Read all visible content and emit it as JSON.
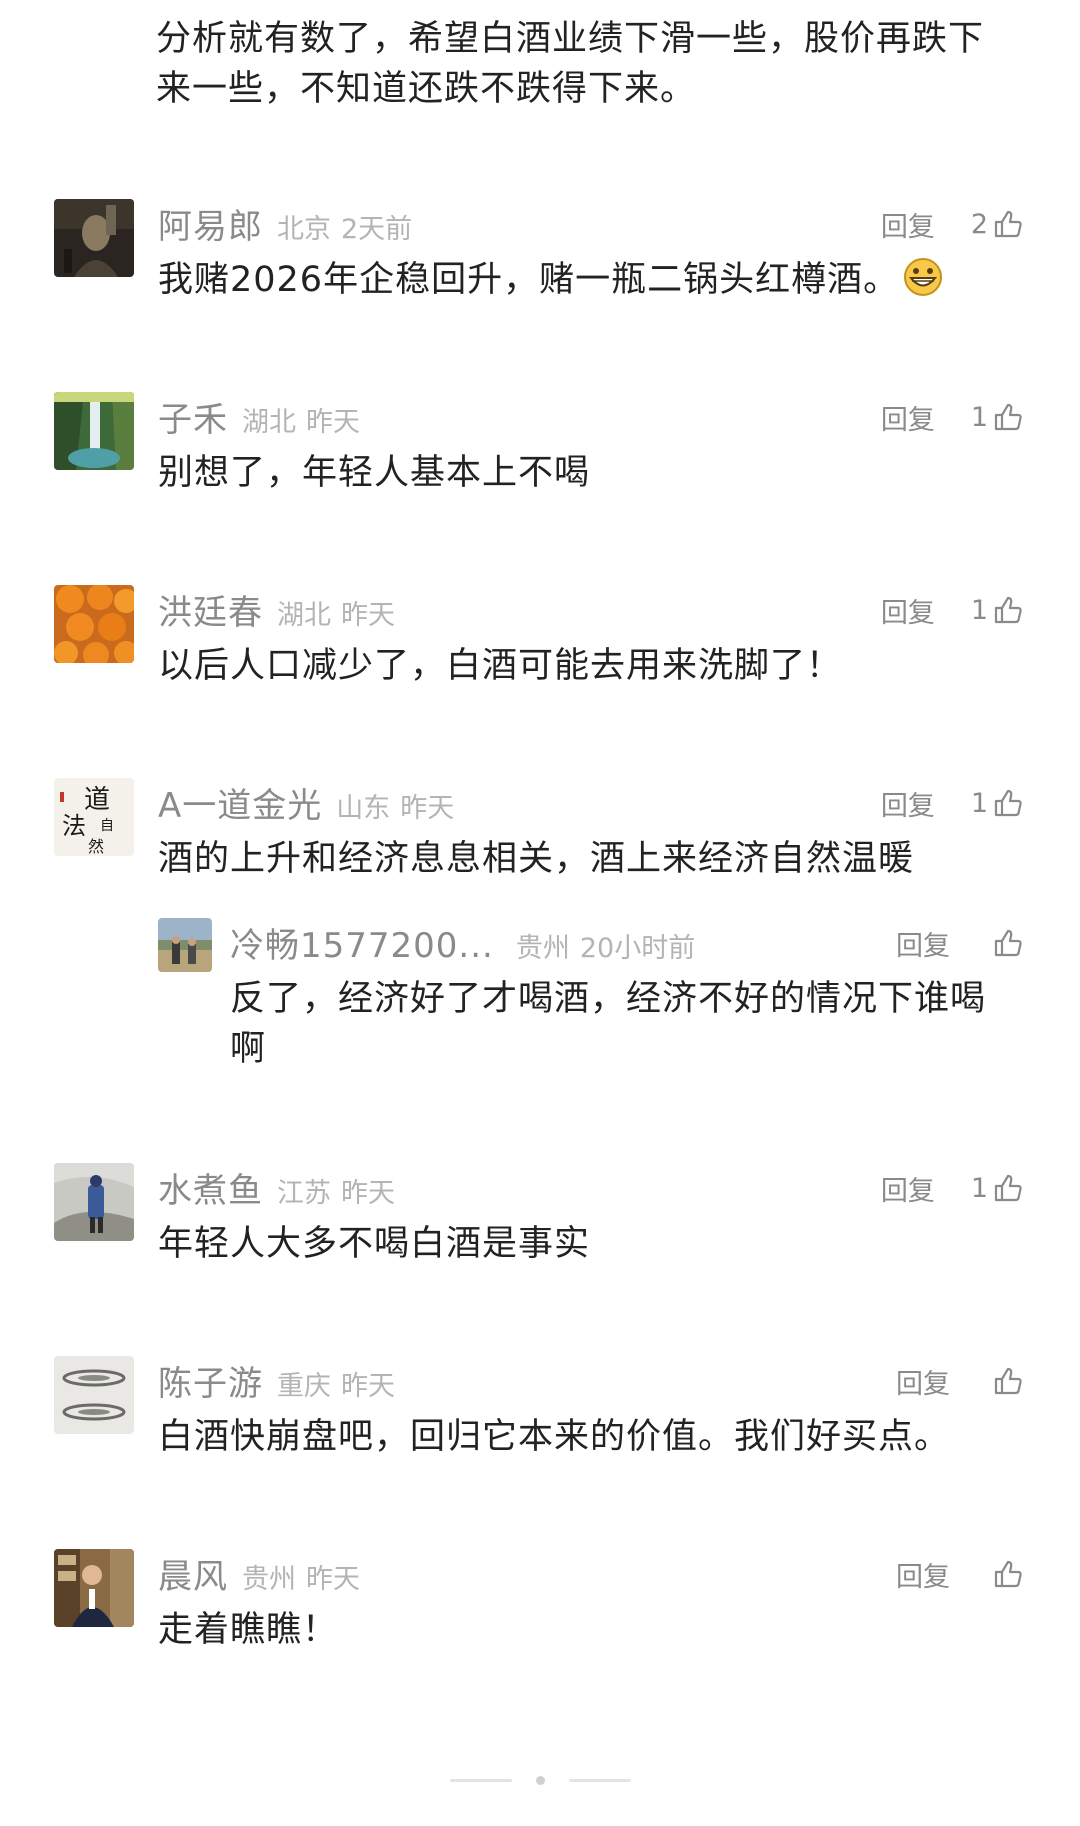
{
  "top_comment": {
    "text": "分析就有数了，希望白酒业绩下滑一些，股价再跌下来一些，不知道还跌不跌得下来。"
  },
  "comments": [
    {
      "username": "阿易郎",
      "location": "北京",
      "time": "2天前",
      "reply_label": "回复",
      "likes": "2",
      "text": "我赌2026年企稳回升，赌一瓶二锅头红樽酒。",
      "emoji": "grin-emoji",
      "avatar": "dark-portrait-avatar"
    },
    {
      "username": "子禾",
      "location": "湖北",
      "time": "昨天",
      "reply_label": "回复",
      "likes": "1",
      "text": "别想了，年轻人基本上不喝",
      "avatar": "waterfall-avatar"
    },
    {
      "username": "洪廷春",
      "location": "湖北",
      "time": "昨天",
      "reply_label": "回复",
      "likes": "1",
      "text": "以后人口减少了，白酒可能去用来洗脚了！",
      "avatar": "persimmons-avatar"
    },
    {
      "username": "A一道金光",
      "location": "山东",
      "time": "昨天",
      "reply_label": "回复",
      "likes": "1",
      "text": "酒的上升和经济息息相关，酒上来经济自然温暖",
      "avatar": "calligraphy-avatar",
      "avatar_chars": [
        "道",
        "法",
        "自",
        "然"
      ],
      "reply": {
        "username": "冷畅1577200...",
        "location": "贵州",
        "time": "20小时前",
        "reply_label": "回复",
        "likes": "",
        "text": "反了，经济好了才喝酒，经济不好的情况下谁喝啊",
        "avatar": "outdoor-people-avatar"
      }
    },
    {
      "username": "水煮鱼",
      "location": "江苏",
      "time": "昨天",
      "reply_label": "回复",
      "likes": "1",
      "text": "年轻人大多不喝白酒是事实",
      "avatar": "hiker-avatar"
    },
    {
      "username": "陈子游",
      "location": "重庆",
      "time": "昨天",
      "reply_label": "回复",
      "likes": "",
      "text": "白酒快崩盘吧，回归它本来的价值。我们好买点。",
      "avatar": "ink-fish-avatar"
    },
    {
      "username": "晨风",
      "location": "贵州",
      "time": "昨天",
      "reply_label": "回复",
      "likes": "",
      "text": "走着瞧瞧！",
      "avatar": "man-in-suit-avatar"
    }
  ],
  "colors": {
    "text": "#222222",
    "username": "#8a8a8a",
    "meta": "#b4b4b4",
    "action": "#8a8a8a"
  }
}
